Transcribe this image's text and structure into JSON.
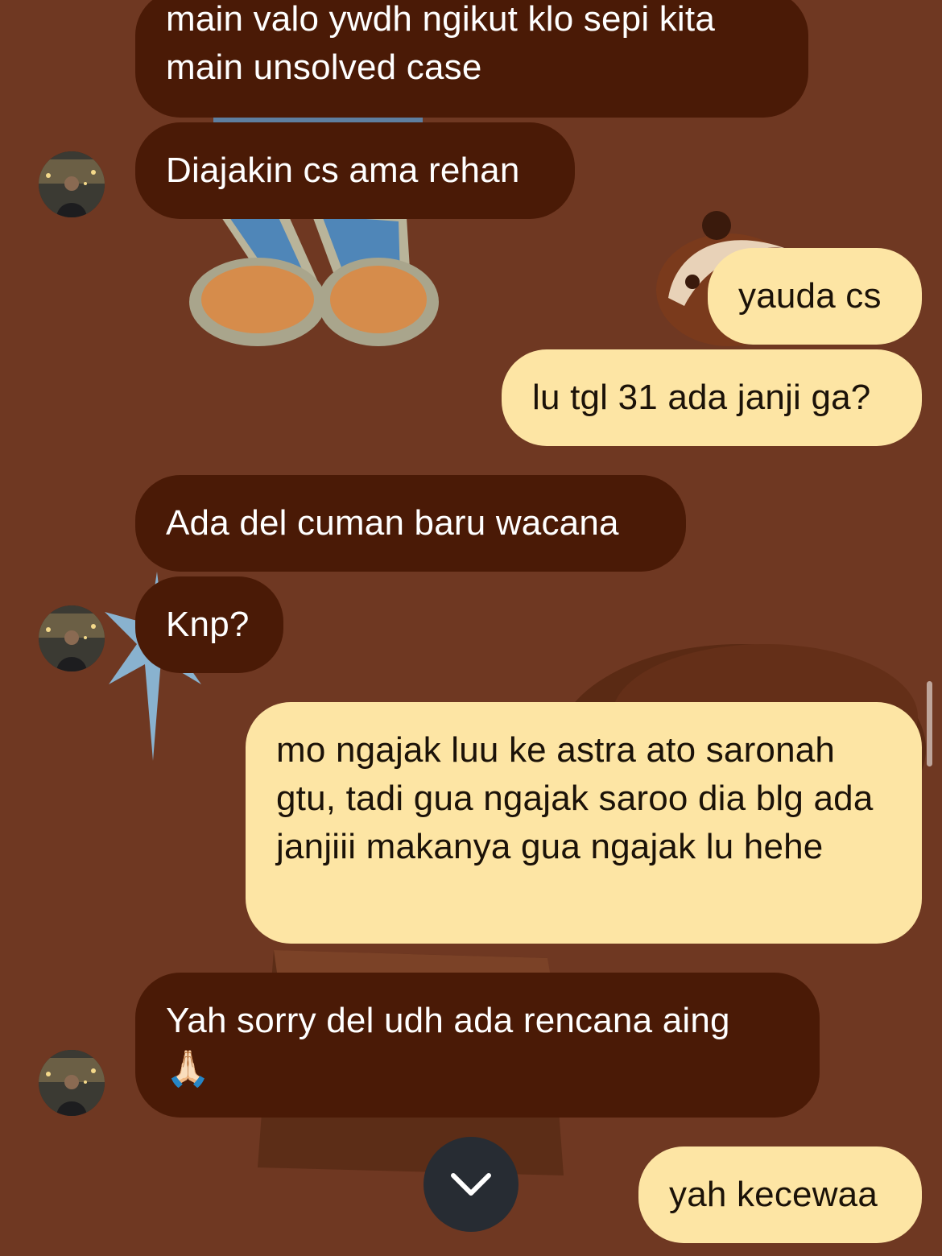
{
  "conversation": {
    "messages": [
      {
        "direction": "incoming",
        "text": "main valo ywdh ngikut klo sepi kita main unsolved case"
      },
      {
        "direction": "incoming",
        "text": "Diajakin cs ama rehan",
        "avatar": true
      },
      {
        "direction": "outgoing",
        "text": "yauda cs"
      },
      {
        "direction": "outgoing",
        "text": "lu tgl 31 ada janji ga?"
      },
      {
        "direction": "incoming",
        "text": "Ada del cuman baru wacana"
      },
      {
        "direction": "incoming",
        "text": "Knp?",
        "avatar": true
      },
      {
        "direction": "outgoing",
        "text": "mo ngajak luu ke astra ato saronah gtu, tadi gua ngajak saroo dia blg ada janjiii makanya gua ngajak lu hehe"
      },
      {
        "direction": "incoming",
        "text": "Yah sorry del udh ada rencana aing",
        "emoji": "🙏🏻",
        "avatar": true
      },
      {
        "direction": "outgoing",
        "text": "yah kecewaa"
      }
    ]
  },
  "controls": {
    "scroll_down_icon": "chevron-down-icon"
  },
  "colors": {
    "background": "#6f3822",
    "incoming_bubble": "#4a1a06",
    "outgoing_bubble": "#fde5a4",
    "scroll_button": "#272c33"
  }
}
